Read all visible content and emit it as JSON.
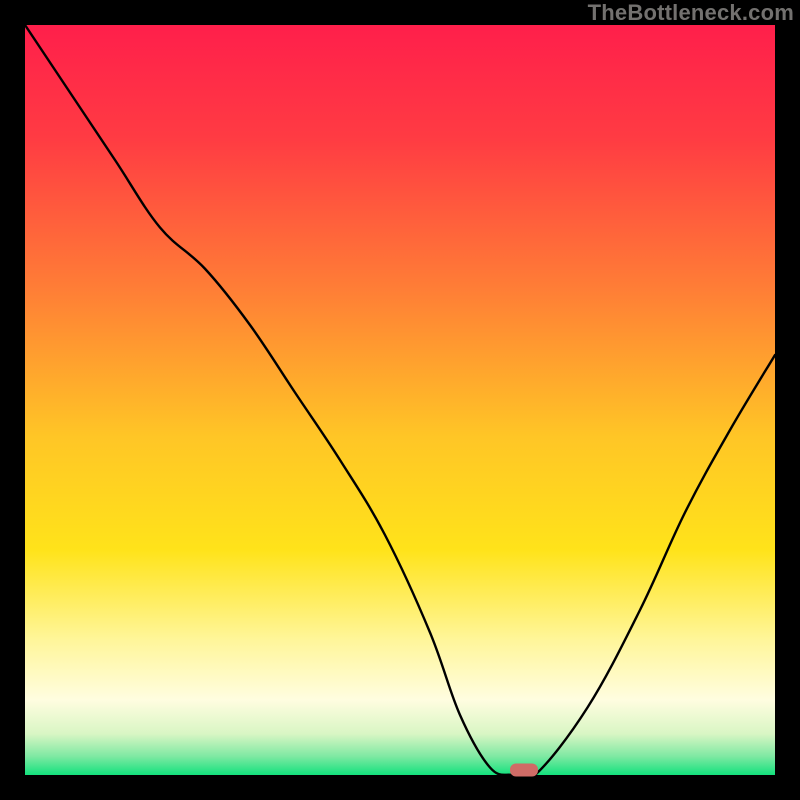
{
  "watermark": "TheBottleneck.com",
  "chart_data": {
    "type": "line",
    "title": "",
    "xlabel": "",
    "ylabel": "",
    "xlim": [
      0,
      100
    ],
    "ylim": [
      0,
      100
    ],
    "grid": false,
    "legend": false,
    "series": [
      {
        "name": "curve",
        "x": [
          0,
          6,
          12,
          18,
          24,
          30,
          36,
          42,
          48,
          54,
          58,
          62,
          65,
          68,
          75,
          82,
          88,
          94,
          100
        ],
        "values": [
          100,
          91,
          82,
          73,
          67.5,
          60,
          51,
          42,
          32,
          19,
          8,
          1,
          0,
          0,
          9,
          22,
          35,
          46,
          56
        ]
      }
    ],
    "marker": {
      "x": 66.5,
      "y": 0.7
    },
    "gradient_stops": [
      {
        "pos": 0.0,
        "color": "#ff1f4b"
      },
      {
        "pos": 0.15,
        "color": "#ff3b43"
      },
      {
        "pos": 0.35,
        "color": "#ff7d36"
      },
      {
        "pos": 0.55,
        "color": "#ffc626"
      },
      {
        "pos": 0.7,
        "color": "#ffe31a"
      },
      {
        "pos": 0.82,
        "color": "#fff69a"
      },
      {
        "pos": 0.9,
        "color": "#fffde0"
      },
      {
        "pos": 0.945,
        "color": "#d9f6c4"
      },
      {
        "pos": 0.975,
        "color": "#7fe9a3"
      },
      {
        "pos": 1.0,
        "color": "#13e17d"
      }
    ]
  }
}
